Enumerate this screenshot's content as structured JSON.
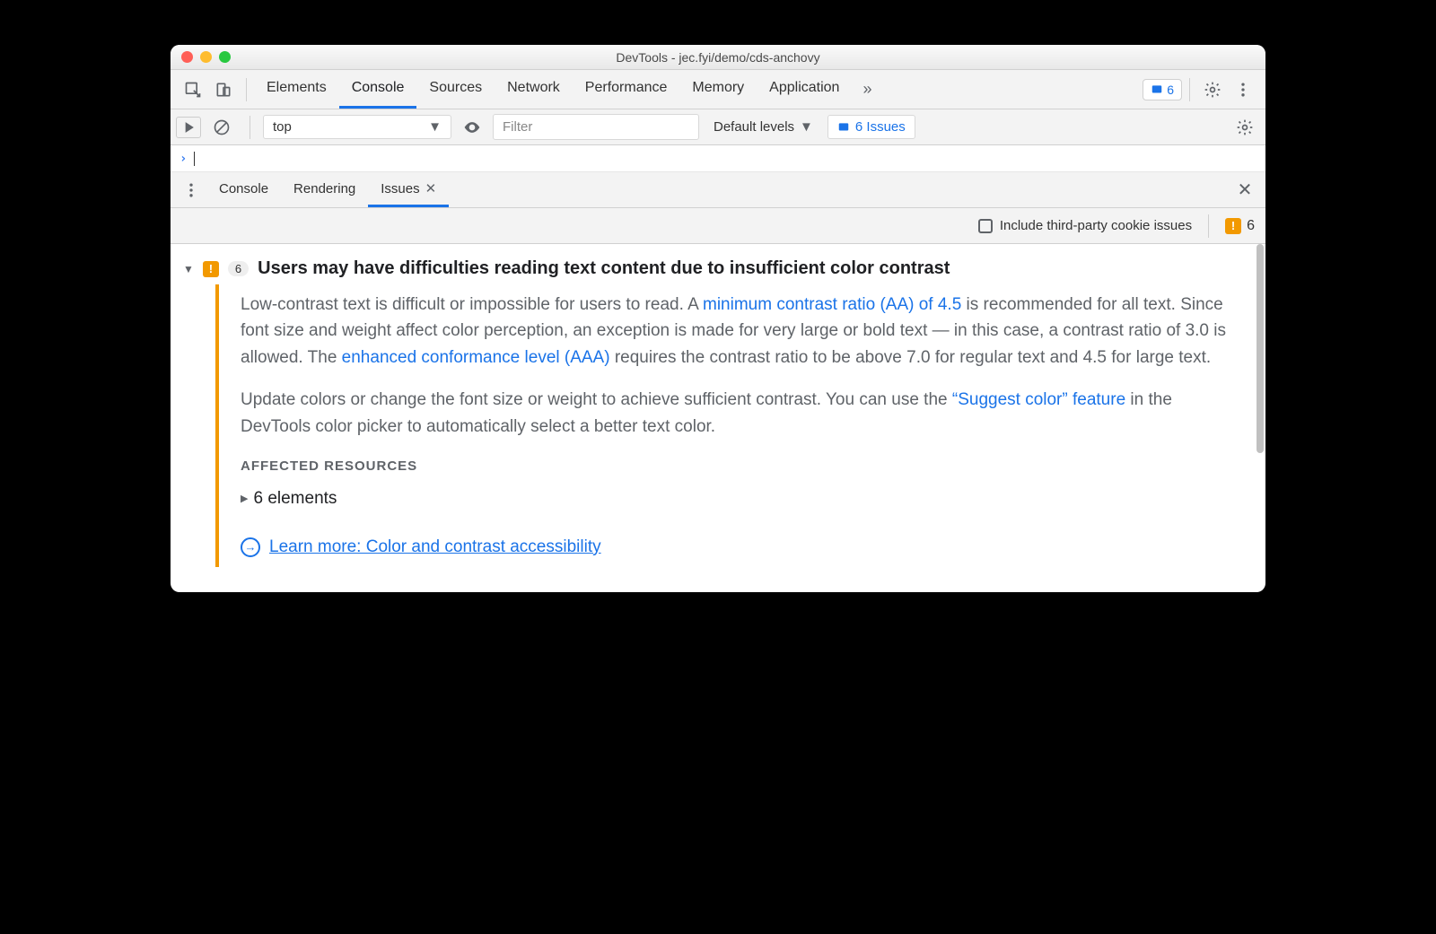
{
  "window": {
    "title": "DevTools - jec.fyi/demo/cds-anchovy"
  },
  "tabs": {
    "items": [
      "Elements",
      "Console",
      "Sources",
      "Network",
      "Performance",
      "Memory",
      "Application"
    ],
    "active_index": 1,
    "issue_count": "6"
  },
  "consolebar": {
    "context": "top",
    "filter_placeholder": "Filter",
    "levels": "Default levels",
    "issues_label": "6 Issues"
  },
  "drawer": {
    "items": [
      "Console",
      "Rendering",
      "Issues"
    ],
    "active_index": 2
  },
  "issues_toolbar": {
    "include_third_party_label": "Include third-party cookie issues",
    "issue_count": "6"
  },
  "issue": {
    "count": "6",
    "title": "Users may have difficulties reading text content due to insufficient color contrast",
    "p1a": "Low-contrast text is difficult or impossible for users to read. A ",
    "p1_link1": "minimum contrast ratio (AA) of 4.5",
    "p1b": " is recommended for all text. Since font size and weight affect color perception, an exception is made for very large or bold text — in this case, a contrast ratio of 3.0 is allowed. The ",
    "p1_link2": "enhanced conformance level (AAA)",
    "p1c": " requires the contrast ratio to be above 7.0 for regular text and 4.5 for large text.",
    "p2a": "Update colors or change the font size or weight to achieve sufficient contrast. You can use the ",
    "p2_link1": "“Suggest color” feature",
    "p2b": " in the DevTools color picker to automatically select a better text color.",
    "affected_heading": "AFFECTED RESOURCES",
    "affected_row": "6 elements",
    "learn_more": "Learn more: Color and contrast accessibility"
  }
}
